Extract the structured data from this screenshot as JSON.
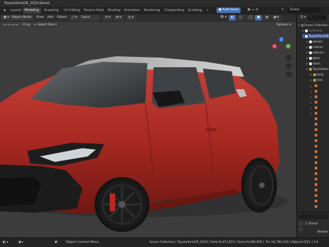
{
  "window": {
    "title": "ToyotaYarisGR_2024.blend"
  },
  "workspaces": [
    "Layout",
    "Modeling",
    "Sculpting",
    "UV Editing",
    "Texture Paint",
    "Shading",
    "Animation",
    "Rendering",
    "Compositing",
    "Scripting"
  ],
  "active_workspace": "Modeling",
  "autosave": {
    "label": "Auto Save"
  },
  "scene": {
    "label": "Scene"
  },
  "header": {
    "mode": "Object Mode",
    "menus": [
      "View",
      "Add",
      "Object"
    ],
    "orientation": "Local",
    "drag_label": "Drag",
    "drag_value": "Select Box",
    "options": "Options"
  },
  "outliner": {
    "items": [
      {
        "label": "Scene Collection",
        "indent": 0,
        "selected": false
      },
      {
        "label": "Collection",
        "indent": 1,
        "selected": false
      },
      {
        "label": "ToyotaYarisGR",
        "indent": 1,
        "selected": true
      },
      {
        "label": "wheels",
        "indent": 2,
        "selected": false
      },
      {
        "label": "interior",
        "indent": 2,
        "selected": false
      },
      {
        "label": "exterior",
        "indent": 2,
        "selected": false
      },
      {
        "label": "glass",
        "indent": 2,
        "selected": false
      },
      {
        "label": "doors",
        "indent": 2,
        "selected": false
      },
      {
        "label": "ToyotaYaris",
        "indent": 2,
        "selected": false
      },
      {
        "label": "body",
        "indent": 3,
        "selected": false
      },
      {
        "label": "trim",
        "indent": 3,
        "selected": false
      }
    ]
  },
  "properties": {
    "scene": "Scene",
    "render": "Render"
  },
  "status": {
    "hint": "Object Context Menu",
    "stats": "Scene Collection | ToyotaYarisGR_2024 | Verts:9,471,873 | Faces:9,390,935 | Tris:18,780,430 | Objects:0/21 | 3.6"
  },
  "colors": {
    "accent": "#4772b3",
    "selection": "#334d80",
    "car_body": "#b8302a"
  }
}
